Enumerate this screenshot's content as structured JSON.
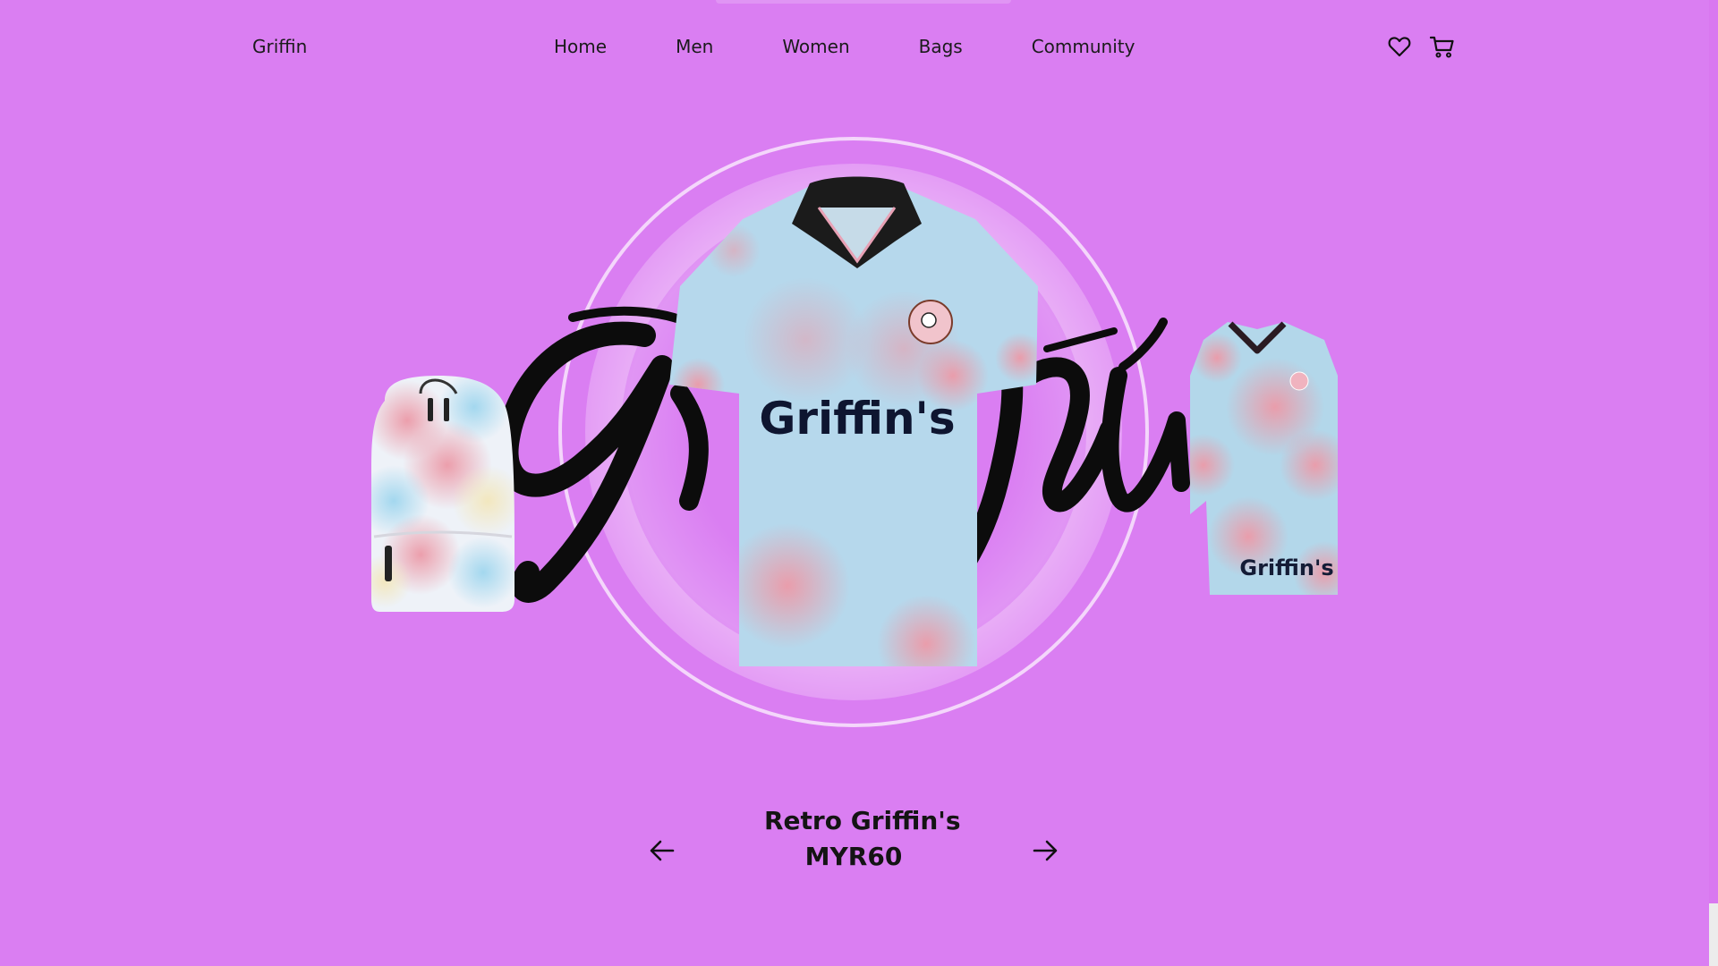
{
  "header": {
    "brand": "Griffin",
    "nav": [
      "Home",
      "Men",
      "Women",
      "Bags",
      "Community"
    ],
    "icons": [
      "heart-icon",
      "cart-icon"
    ]
  },
  "hero": {
    "script_text": "Griffin",
    "jersey_print": "Griffin's",
    "dress_print": "Griffin's"
  },
  "product": {
    "name": "Retro Griffin's",
    "price": "MYR60"
  },
  "carousel": {
    "prev_icon": "arrow-left-icon",
    "next_icon": "arrow-right-icon"
  },
  "colors": {
    "background": "#da7ef2",
    "text": "#1b1b1b",
    "jersey": "#b6d8ec",
    "tie_dye_pink": "#e99aaa"
  }
}
